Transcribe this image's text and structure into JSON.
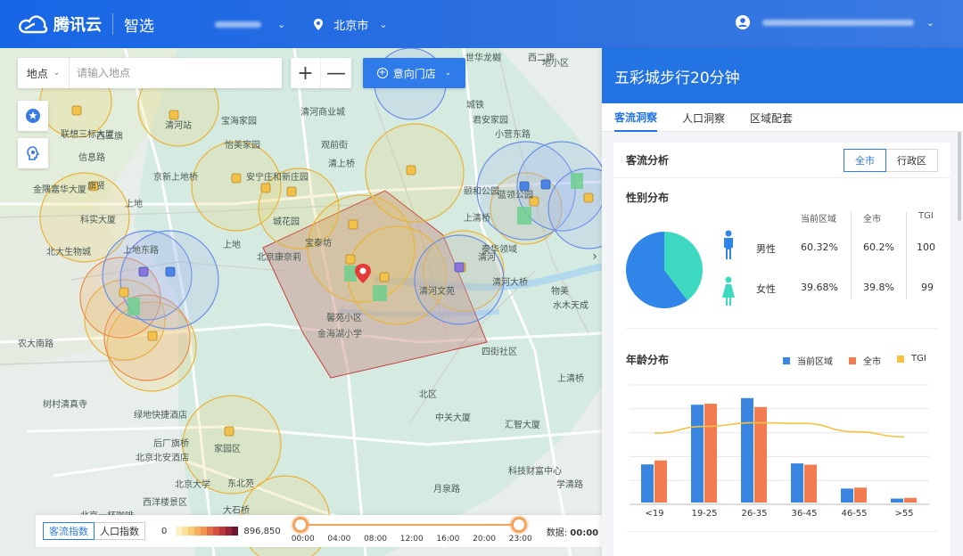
{
  "header": {
    "brand": "腾讯云",
    "product": "智选",
    "city": "北京市"
  },
  "map": {
    "search_type": "地点",
    "search_placeholder": "请输入地点",
    "zoom_in": "+",
    "zoom_out": "—",
    "store_button": "意向门店",
    "labels": [
      "世华龙樾",
      "西二旗",
      "地小区",
      "联想",
      "清河站",
      "宝海家园",
      "清河商业城",
      "城铁",
      "小营东路",
      "联想三标大厦",
      "西三旗",
      "怡美家园",
      "观前街",
      "君安家园",
      "信息路",
      "京新上地桥",
      "清上桥",
      "安宁庄和新庄园",
      "城花园",
      "颐和公园",
      "金隅嘉华大厦",
      "旗贤",
      "上地",
      "北京康奈莉",
      "上清桥",
      "科实大厦",
      "泰华领域",
      "北大生物城",
      "上地东路",
      "上地",
      "清河",
      "宝泰坊",
      "蓝领公园",
      "清河大桥",
      "清河文苑",
      "物美",
      "水木天成",
      "馨苑小区",
      "金海湖小学",
      "农大南路",
      "四街社区",
      "树村清真寺",
      "上清桥",
      "北区",
      "绿地快捷酒店",
      "中关大厦",
      "汇智大厦",
      "后厂旗桥",
      "家园区",
      "北京北安酒店",
      "北京大学",
      "东北苑",
      "西洋楼景区",
      "月泉路",
      "学清路",
      "科技财富中心",
      "大石桥",
      "北京一杯咖啡",
      "北京体育大学"
    ]
  },
  "timeline": {
    "tabs": [
      "客流指数",
      "人口指数"
    ],
    "min": "0",
    "max": "896,850",
    "ticks": [
      "00:00",
      "04:00",
      "08:00",
      "12:00",
      "16:00",
      "20:00",
      "23:00"
    ],
    "data_label": "数据:",
    "data_value": "00:00",
    "range_start_fraction": 0.0,
    "range_end_fraction": 1.0
  },
  "panel": {
    "title": "五彩城步行20分钟",
    "tabs": [
      "客流洞察",
      "人口洞察",
      "区域配套"
    ],
    "card_title": "客流分析",
    "scope_buttons": [
      "全市",
      "行政区"
    ],
    "gender": {
      "title": "性别分布",
      "headers": [
        "当前区域",
        "全市",
        "TGI"
      ],
      "rows": [
        {
          "label": "男性",
          "current": "60.32%",
          "city": "60.2%",
          "tgi": "100"
        },
        {
          "label": "女性",
          "current": "39.68%",
          "city": "39.8%",
          "tgi": "99"
        }
      ],
      "pie": [
        60.32,
        39.68
      ]
    },
    "age": {
      "title": "年龄分布",
      "legend": [
        "当前区域",
        "全市",
        "TGI"
      ]
    }
  },
  "colors": {
    "brand": "#2373e3",
    "male": "#2f86e8",
    "female": "#3dd9c1",
    "current": "#3a85e0",
    "city": "#f27c50",
    "tgi": "#f5c242"
  },
  "chart_data": {
    "type": "bar",
    "categories": [
      "<19",
      "19-25",
      "26-35",
      "36-45",
      "46-55",
      ">55"
    ],
    "series": [
      {
        "name": "当前区域",
        "values": [
          11.5,
          29.5,
          31.5,
          11.8,
          4.2,
          1.2
        ]
      },
      {
        "name": "全市",
        "values": [
          12.7,
          29.8,
          28.8,
          11.4,
          4.5,
          1.4
        ]
      },
      {
        "name": "TGI",
        "values": [
          93,
          102,
          107,
          106,
          95,
          88
        ]
      }
    ],
    "ylim": [
      0,
      36
    ],
    "grid": true,
    "legend": "top-right"
  }
}
